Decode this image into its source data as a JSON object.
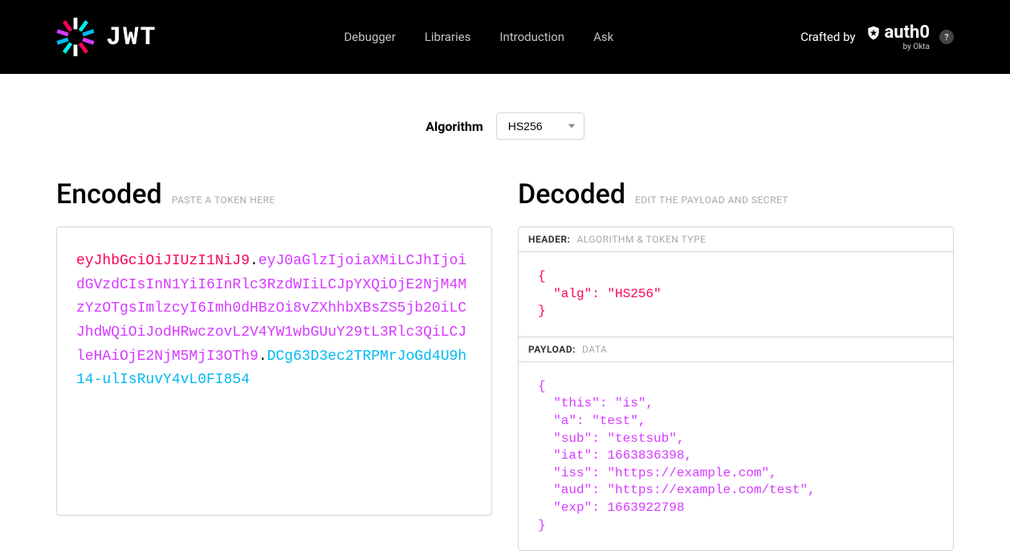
{
  "nav": {
    "brand_text": "JWT",
    "links": [
      "Debugger",
      "Libraries",
      "Introduction",
      "Ask"
    ],
    "crafted_by": "Crafted by",
    "auth0": "auth0",
    "auth0_sub": "by Okta",
    "help": "?"
  },
  "algorithm": {
    "label": "Algorithm",
    "selected": "HS256"
  },
  "encoded": {
    "title": "Encoded",
    "hint": "PASTE A TOKEN HERE",
    "header_segment": "eyJhbGciOiJIUzI1NiJ9",
    "payload_segment": "eyJ0aGlzIjoiaXMiLCJhIjoidGVzdCIsInN1YiI6InRlc3RzdWIiLCJpYXQiOjE2NjM4MzYzOTgsImlzcyI6Imh0dHBzOi8vZXhhbXBsZS5jb20iLCJhdWQiOiJodHRwczovL2V4YW1wbGUuY29tL3Rlc3QiLCJleHAiOjE2NjM5MjI3OTh9",
    "signature_segment": "DCg63D3ec2TRPMrJoGd4U9h14-ulIsRuvY4vL0FI854"
  },
  "decoded": {
    "title": "Decoded",
    "hint": "EDIT THE PAYLOAD AND SECRET",
    "header_label": "HEADER:",
    "header_desc": "ALGORITHM & TOKEN TYPE",
    "header_json": "{\n  \"alg\": \"HS256\"\n}",
    "payload_label": "PAYLOAD:",
    "payload_desc": "DATA",
    "payload_json": "{\n  \"this\": \"is\",\n  \"a\": \"test\",\n  \"sub\": \"testsub\",\n  \"iat\": 1663836398,\n  \"iss\": \"https://example.com\",\n  \"aud\": \"https://example.com/test\",\n  \"exp\": 1663922798\n}"
  }
}
